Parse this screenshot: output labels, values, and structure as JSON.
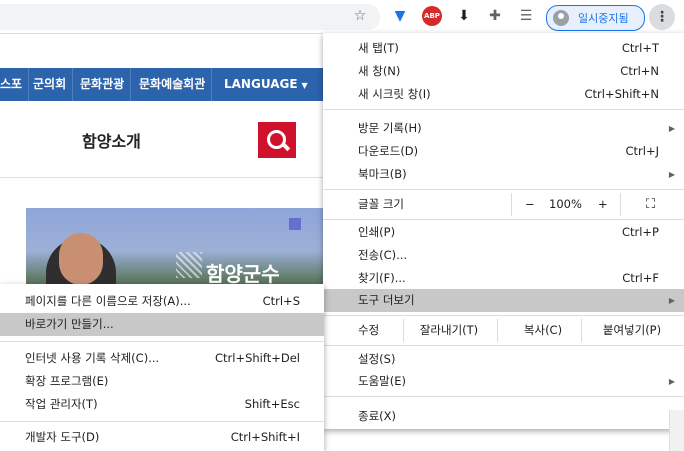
{
  "toolbar": {
    "icons": [
      "star-icon",
      "vpn-icon",
      "adblock-plus-icon",
      "download-extension-icon",
      "puzzle-icon",
      "reading-list-icon"
    ],
    "abp_text": "ABP",
    "profile_label": "일시중지됨",
    "menu_icon": "⋮"
  },
  "page": {
    "nav": [
      "스포",
      "군의회",
      "문화관광",
      "문화예술회관",
      "LANGUAGE"
    ],
    "heading": "함양소개",
    "banner_text": "함양군수"
  },
  "main_menu": {
    "new_tab": {
      "label": "새 탭(T)",
      "shortcut": "Ctrl+T"
    },
    "new_window": {
      "label": "새 창(N)",
      "shortcut": "Ctrl+N"
    },
    "incognito": {
      "label": "새 시크릿 창(I)",
      "shortcut": "Ctrl+Shift+N"
    },
    "history": {
      "label": "방문 기록(H)"
    },
    "downloads": {
      "label": "다운로드(D)",
      "shortcut": "Ctrl+J"
    },
    "bookmarks": {
      "label": "북마크(B)"
    },
    "zoom": {
      "label": "글꼴 크기",
      "minus": "−",
      "value": "100%",
      "plus": "+"
    },
    "print": {
      "label": "인쇄(P)",
      "shortcut": "Ctrl+P"
    },
    "cast": {
      "label": "전송(C)..."
    },
    "find": {
      "label": "찾기(F)...",
      "shortcut": "Ctrl+F"
    },
    "more_tools": {
      "label": "도구 더보기"
    },
    "edit": {
      "label": "수정",
      "cut": "잘라내기(T)",
      "copy": "복사(C)",
      "paste": "붙여넣기(P)"
    },
    "settings": {
      "label": "설정(S)"
    },
    "help": {
      "label": "도움말(E)"
    },
    "exit": {
      "label": "종료(X)"
    }
  },
  "sub_menu": {
    "save_as": {
      "label": "페이지를 다른 이름으로 저장(A)...",
      "shortcut": "Ctrl+S"
    },
    "create_shortcut": {
      "label": "바로가기 만들기..."
    },
    "clear_data": {
      "label": "인터넷 사용 기록 삭제(C)...",
      "shortcut": "Ctrl+Shift+Del"
    },
    "extensions": {
      "label": "확장 프로그램(E)"
    },
    "task_manager": {
      "label": "작업 관리자(T)",
      "shortcut": "Shift+Esc"
    },
    "dev_tools": {
      "label": "개발자 도구(D)",
      "shortcut": "Ctrl+Shift+I"
    }
  },
  "colors": {
    "nav_bg": "#2b63ad",
    "search_btn": "#d0112b",
    "highlight": "#c8c8c8",
    "accent": "#1a73e8"
  }
}
